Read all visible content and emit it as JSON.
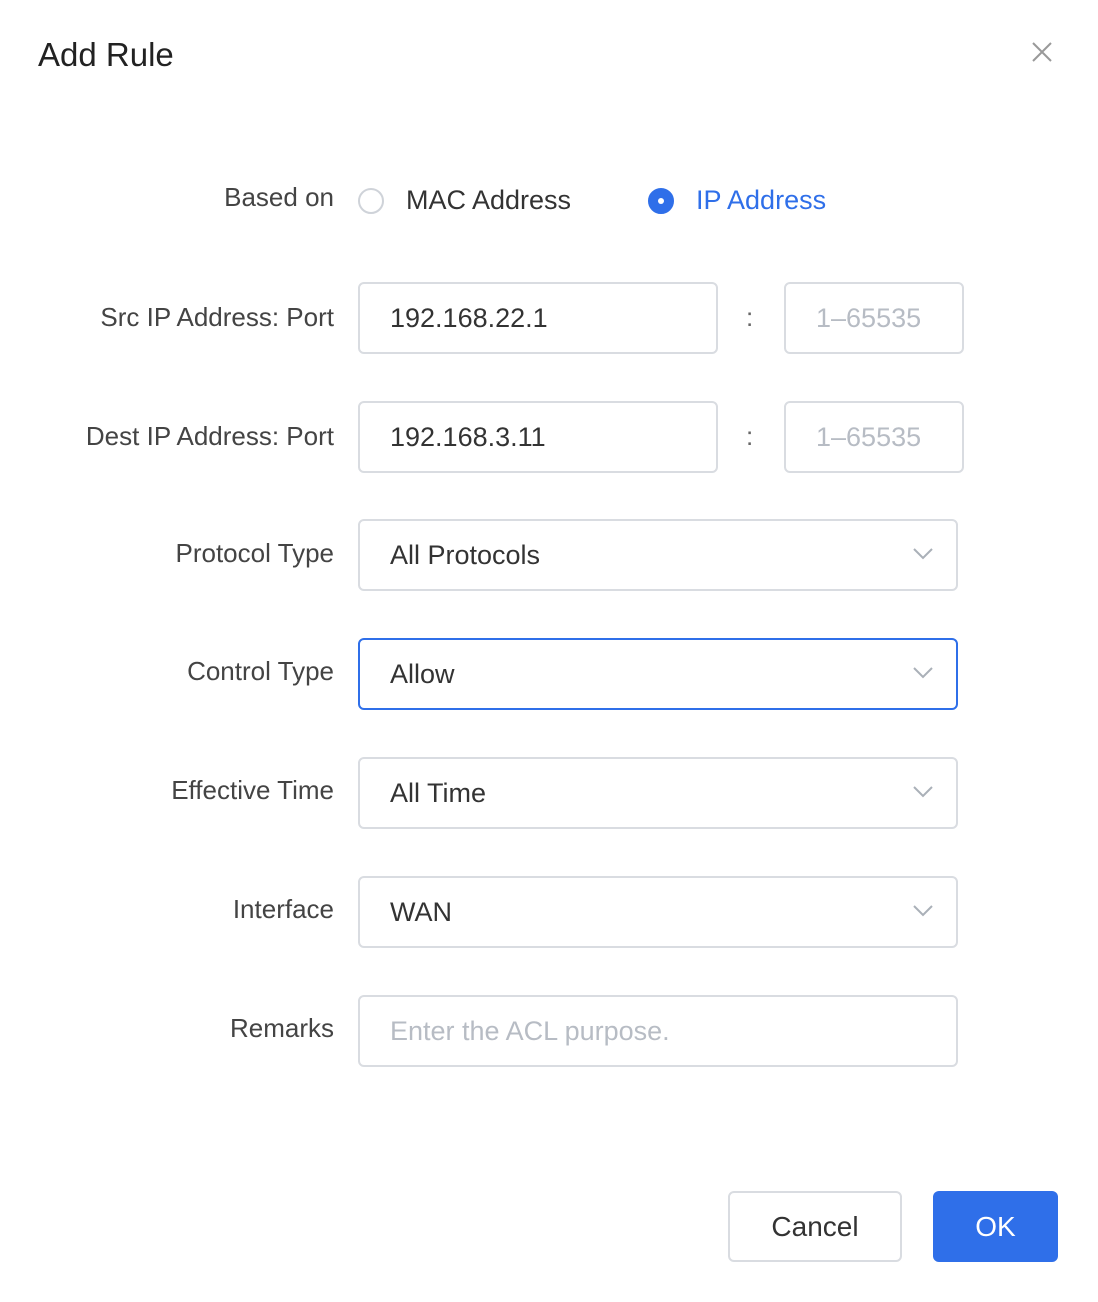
{
  "dialog": {
    "title": "Add Rule"
  },
  "form": {
    "based_on": {
      "label": "Based on",
      "options": [
        {
          "label": "MAC Address",
          "checked": false
        },
        {
          "label": "IP Address",
          "checked": true
        }
      ]
    },
    "src": {
      "label": "Src IP Address: Port",
      "ip_value": "192.168.22.1",
      "port_placeholder": "1–65535",
      "separator": ":"
    },
    "dest": {
      "label": "Dest IP Address: Port",
      "ip_value": "192.168.3.11",
      "port_placeholder": "1–65535",
      "separator": ":"
    },
    "protocol_type": {
      "label": "Protocol Type",
      "value": "All Protocols"
    },
    "control_type": {
      "label": "Control Type",
      "value": "Allow"
    },
    "effective_time": {
      "label": "Effective Time",
      "value": "All Time"
    },
    "interface": {
      "label": "Interface",
      "value": "WAN"
    },
    "remarks": {
      "label": "Remarks",
      "placeholder": "Enter the ACL purpose."
    }
  },
  "footer": {
    "cancel_label": "Cancel",
    "ok_label": "OK"
  },
  "colors": {
    "accent": "#2f6fe9",
    "border": "#d9dce1",
    "placeholder": "#b7bcc4"
  }
}
